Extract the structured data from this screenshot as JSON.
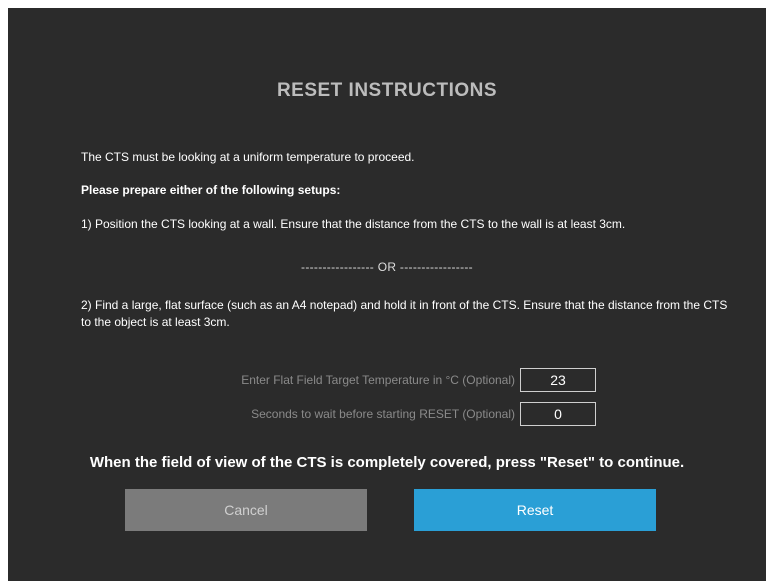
{
  "dialog": {
    "title": "RESET INSTRUCTIONS",
    "paragraphs": {
      "intro": "The CTS must be looking at a uniform temperature to proceed.",
      "prepare": "Please prepare either of the following setups:",
      "option1": "1) Position the CTS looking at a wall. Ensure that the distance from the CTS to the wall is at least 3cm.",
      "or_separator": "----------------- OR -----------------",
      "option2": "2) Find a large, flat surface (such as an A4 notepad) and hold it in front of the CTS. Ensure that the distance from the CTS to the object is at least 3cm."
    },
    "fields": {
      "temperature": {
        "label": "Enter Flat Field Target Temperature in °C (Optional)",
        "value": "23"
      },
      "wait_seconds": {
        "label": "Seconds to wait before starting RESET (Optional)",
        "value": "0"
      }
    },
    "instruction": "When the field of view of the CTS is completely covered, press \"Reset\" to continue.",
    "buttons": {
      "cancel": "Cancel",
      "reset": "Reset"
    }
  },
  "colors": {
    "background": "#2b2b2b",
    "title": "#bcbcbc",
    "cancel_button": "#7b7b7b",
    "reset_button": "#2a9fd6"
  }
}
